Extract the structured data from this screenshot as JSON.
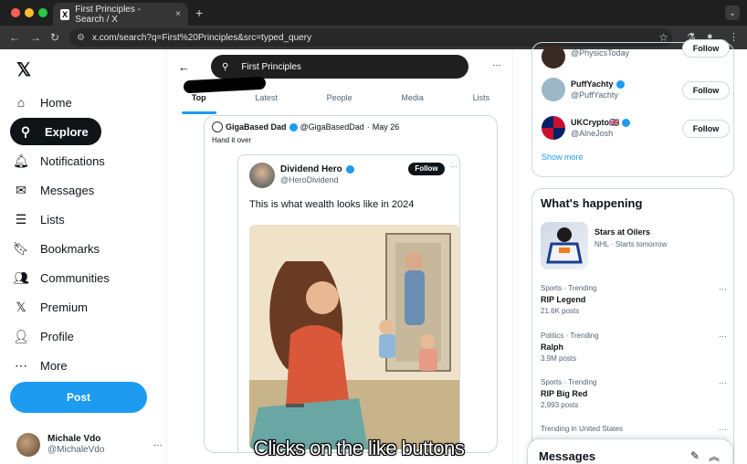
{
  "browser": {
    "tab_title": "First Principles - Search / X",
    "tab_favicon": "X",
    "tab_close": "×",
    "new_tab": "+",
    "url": "x.com/search?q=First%20Principles&src=typed_query",
    "colors": {
      "chrome_dark": "#1f1f1f",
      "chrome_bar": "#353535",
      "dot_red": "#ff5f57",
      "dot_yellow": "#febc2e",
      "dot_green": "#28c840"
    }
  },
  "left_nav": {
    "logo": "𝕏",
    "items": [
      {
        "label": "Home",
        "icon": "home-icon",
        "glyph": "⌂"
      },
      {
        "label": "Explore",
        "icon": "search-icon",
        "glyph": "⚲",
        "active": true
      },
      {
        "label": "Notifications",
        "icon": "bell-icon",
        "glyph": "🔔︎"
      },
      {
        "label": "Messages",
        "icon": "envelope-icon",
        "glyph": "✉"
      },
      {
        "label": "Lists",
        "icon": "list-icon",
        "glyph": "☰"
      },
      {
        "label": "Bookmarks",
        "icon": "bookmark-icon",
        "glyph": "🔖︎"
      },
      {
        "label": "Communities",
        "icon": "people-icon",
        "glyph": "👥︎"
      },
      {
        "label": "Premium",
        "icon": "x-icon",
        "glyph": "𝕏"
      },
      {
        "label": "Profile",
        "icon": "person-icon",
        "glyph": "👤︎"
      },
      {
        "label": "More",
        "icon": "more-circle-icon",
        "glyph": "⋯"
      }
    ],
    "post_label": "Post",
    "account": {
      "name": "Michale Vdo",
      "handle": "@MichaleVdo",
      "more": "···"
    }
  },
  "search": {
    "query": "First Principles",
    "tabs": [
      {
        "label": "Top",
        "selected": true
      },
      {
        "label": "Latest"
      },
      {
        "label": "People"
      },
      {
        "label": "Media"
      },
      {
        "label": "Lists"
      }
    ]
  },
  "tweet": {
    "author": "GigaBased Dad",
    "handle": "@GigaBasedDad",
    "date": "May 26",
    "sep": "·",
    "text": "Hand it over",
    "embed": {
      "name": "Dividend Hero",
      "handle": "@HeroDividend",
      "follow": "Follow",
      "more": "···",
      "text": "This is what wealth looks like in 2024"
    }
  },
  "who_to_follow": {
    "accounts": [
      {
        "name": "",
        "handle": "@PhysicsToday",
        "follow": "Follow"
      },
      {
        "name": "PuffYachty",
        "handle": "@PuffYachty",
        "follow": "Follow"
      },
      {
        "name": "UKCrypto🇬🇧",
        "handle": "@AlneJosh",
        "follow": "Follow"
      }
    ],
    "show_more": "Show more"
  },
  "happening": {
    "title": "What's happening",
    "event": {
      "name": "Stars at Oilers",
      "subtitle": "NHL · Starts tomorrow"
    },
    "trends": [
      {
        "context": "Sports · Trending",
        "name": "RIP Legend",
        "count": "21.6K posts"
      },
      {
        "context": "Politics · Trending",
        "name": "Ralph",
        "count": "3.9M posts"
      },
      {
        "context": "Sports · Trending",
        "name": "RIP Big Red",
        "count": "2,993 posts"
      },
      {
        "context": "Trending in United States",
        "name": "",
        "count": ""
      }
    ]
  },
  "messages_drawer": {
    "title": "Messages"
  },
  "caption": "Clicks on the like buttons"
}
